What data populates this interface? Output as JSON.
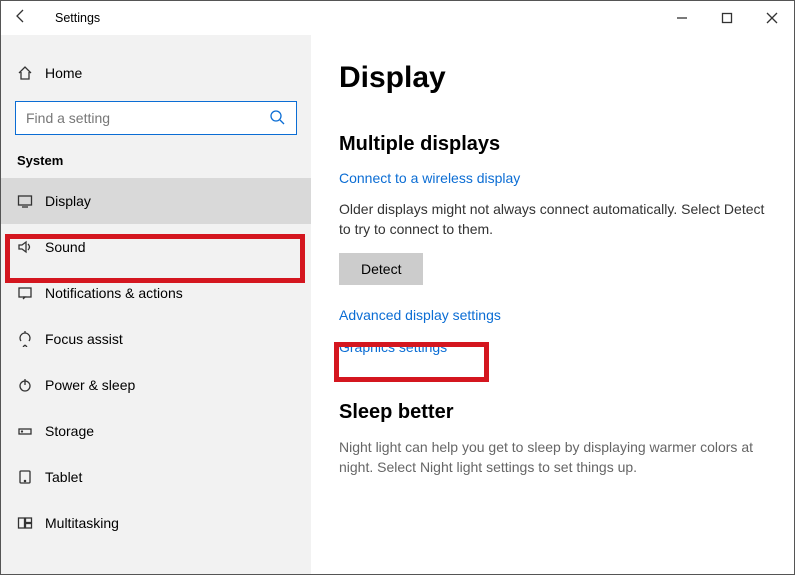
{
  "titlebar": {
    "title": "Settings"
  },
  "sidebar": {
    "home_label": "Home",
    "search_placeholder": "Find a setting",
    "category_label": "System",
    "items": [
      {
        "label": "Display"
      },
      {
        "label": "Sound"
      },
      {
        "label": "Notifications & actions"
      },
      {
        "label": "Focus assist"
      },
      {
        "label": "Power & sleep"
      },
      {
        "label": "Storage"
      },
      {
        "label": "Tablet"
      },
      {
        "label": "Multitasking"
      }
    ]
  },
  "main": {
    "page_title": "Display",
    "multi_section": "Multiple displays",
    "wireless_link": "Connect to a wireless display",
    "older_desc": "Older displays might not always connect automatically. Select Detect to try to connect to them.",
    "detect_btn": "Detect",
    "adv_link": "Advanced display settings",
    "graphics_link": "Graphics settings",
    "sleep_section": "Sleep better",
    "sleep_desc": "Night light can help you get to sleep by displaying warmer colors at night. Select Night light settings to set things up."
  }
}
